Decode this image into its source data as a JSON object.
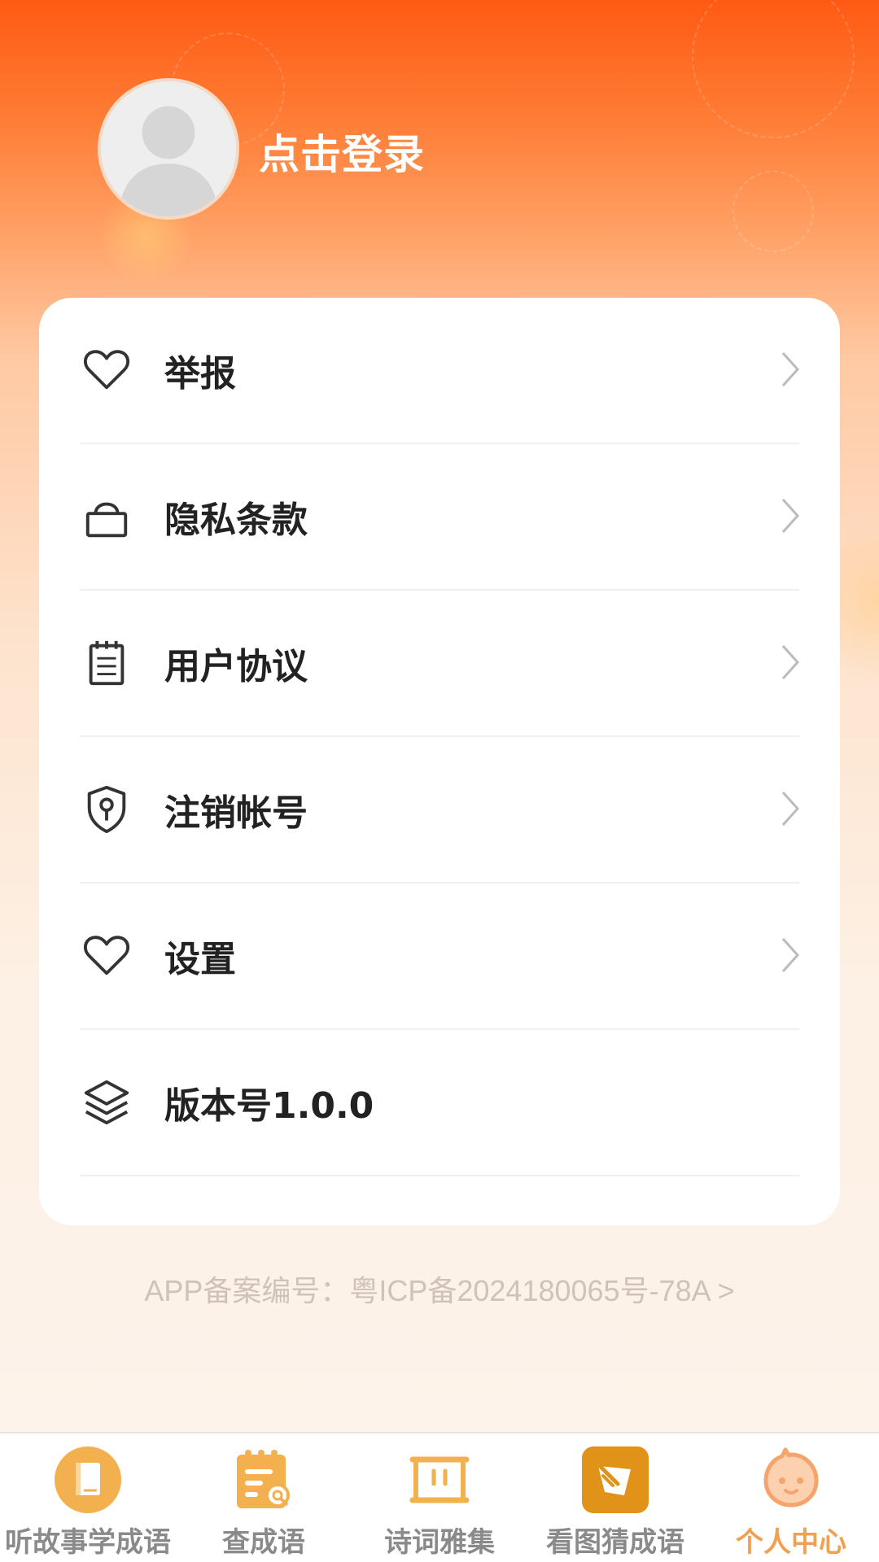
{
  "header": {
    "login_label": "点击登录"
  },
  "menu": {
    "items": [
      {
        "label": "举报",
        "icon": "heart-icon",
        "has_arrow": true
      },
      {
        "label": "隐私条款",
        "icon": "lock-icon",
        "has_arrow": true
      },
      {
        "label": "用户协议",
        "icon": "notepad-icon",
        "has_arrow": true
      },
      {
        "label": "注销帐号",
        "icon": "shield-key-icon",
        "has_arrow": true
      },
      {
        "label": "设置",
        "icon": "heart-icon",
        "has_arrow": true
      },
      {
        "label": "版本号1.0.0",
        "icon": "layers-icon",
        "has_arrow": false
      }
    ]
  },
  "footer": {
    "icp_text": "APP备案编号：粤ICP备2024180065号-78A  >"
  },
  "tabbar": {
    "tabs": [
      {
        "label": "听故事学成语",
        "icon": "book-icon",
        "active": false
      },
      {
        "label": "查成语",
        "icon": "calendar-search-icon",
        "active": false
      },
      {
        "label": "诗词雅集",
        "icon": "scroll-icon",
        "active": false
      },
      {
        "label": "看图猜成语",
        "icon": "picture-brush-icon",
        "active": false
      },
      {
        "label": "个人中心",
        "icon": "smiley-face-icon",
        "active": true
      }
    ]
  },
  "colors": {
    "header_top": "#ff5a14",
    "active_tab": "#f0a050",
    "tab_icon_orange": "#f3b04e",
    "text_dark": "#222222"
  }
}
